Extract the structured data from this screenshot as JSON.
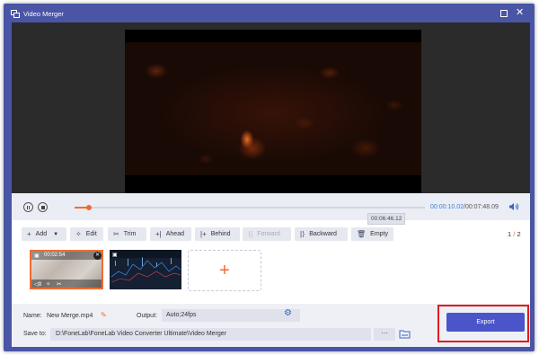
{
  "window": {
    "title": "Video Merger"
  },
  "player": {
    "tooltip_time": "00:06:46.12",
    "current_time": "00:00:10.02",
    "separator": "/",
    "total_time": "00:07:48.09",
    "progress": 0.04
  },
  "toolbar": {
    "add": "Add",
    "edit": "Edit",
    "trim": "Trim",
    "ahead": "Ahead",
    "behind": "Behind",
    "forward": "Forward",
    "backward": "Backward",
    "empty": "Empty",
    "page_current": "1",
    "page_sep": "/",
    "page_total": "2"
  },
  "clips": [
    {
      "duration": "00:02:54"
    }
  ],
  "output": {
    "name_label": "Name:",
    "name_value": "New Merge.mp4",
    "output_label": "Output:",
    "output_value": "Auto;24fps",
    "save_label": "Save to:",
    "save_path": "D:\\FoneLab\\FoneLab Video Converter Ultimate\\Video Merger",
    "browse_label": "···",
    "export_label": "Export"
  },
  "colors": {
    "accent": "#f06a30",
    "primary": "#4a55c9",
    "highlight": "#e31b1b",
    "titlebar": "#4a55a5"
  }
}
